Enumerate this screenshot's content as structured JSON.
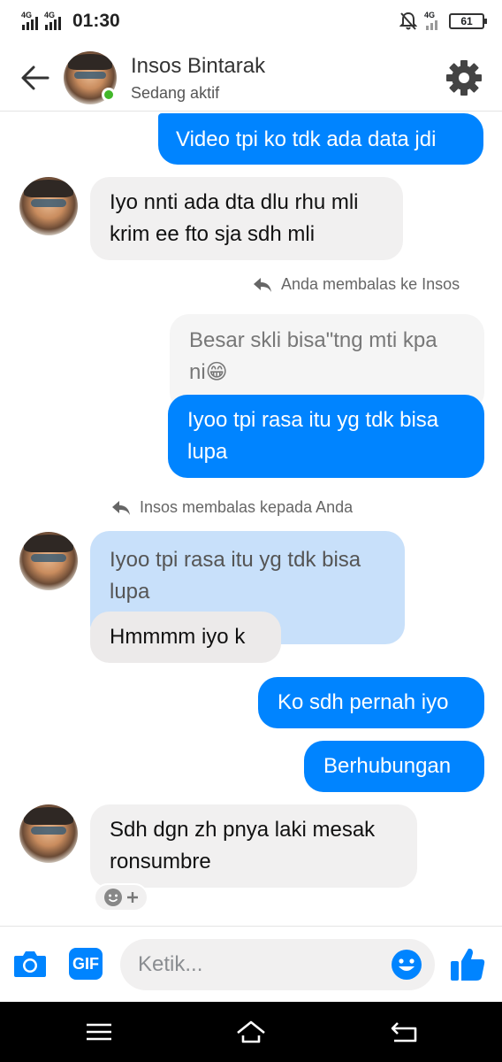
{
  "status_bar": {
    "network1": "4G",
    "network2": "4G",
    "time": "01:30",
    "net_right": "4G",
    "battery": "61"
  },
  "header": {
    "contact_name": "Insos Bintarak",
    "status": "Sedang aktif"
  },
  "messages": {
    "m1": "Video tpi ko tdk ada data jdi",
    "m2_line1": "Iyo nnti ada dta dlu rhu mli",
    "m2_line2": "krim ee fto sja sdh mli",
    "reply_note_1": "Anda membalas ke Insos",
    "m3_quoted_line1": "Besar skli bisa\"tng mti kpa",
    "m3_quoted_line2": "ni😁",
    "m3_line1": "Iyoo tpi rasa itu yg tdk bisa",
    "m3_line2": "lupa",
    "reply_note_2": "Insos membalas kepada Anda",
    "m4_quoted_line1": "Iyoo tpi rasa itu yg tdk bisa",
    "m4_quoted_line2": "lupa",
    "m4": "Hmmmm iyo k",
    "m5": "Ko sdh pernah iyo",
    "m6": "Berhubungan",
    "m7_line1": "Sdh dgn zh pnya laki mesak",
    "m7_line2": "ronsumbre"
  },
  "composer": {
    "gif_label": "GIF",
    "placeholder": "Ketik..."
  },
  "colors": {
    "accent": "#0084ff",
    "incoming_bubble": "#f1f0f0",
    "online": "#42b72a"
  }
}
